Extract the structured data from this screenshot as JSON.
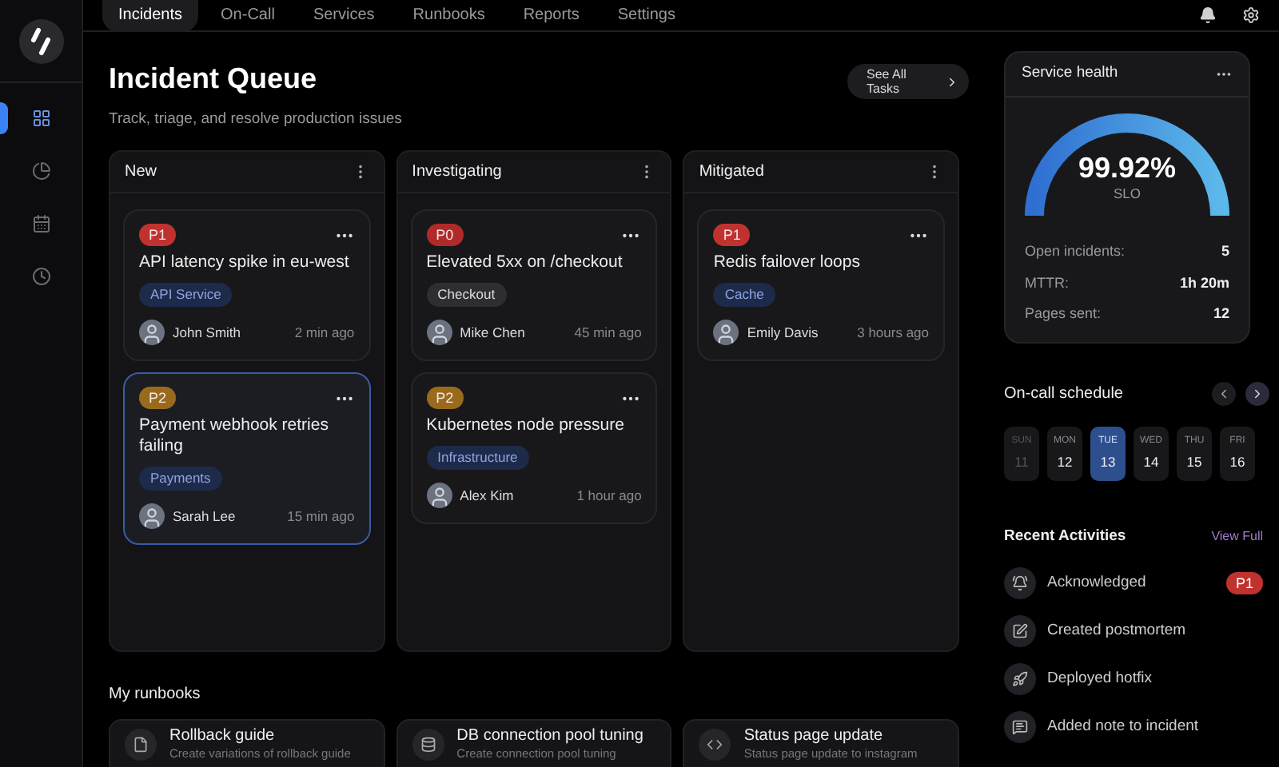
{
  "nav": {
    "tabs": [
      {
        "label": "Incidents",
        "selected": true
      },
      {
        "label": "On-Call",
        "selected": false
      },
      {
        "label": "Services",
        "selected": false
      },
      {
        "label": "Runbooks",
        "selected": false
      },
      {
        "label": "Reports",
        "selected": false
      },
      {
        "label": "Settings",
        "selected": false
      }
    ]
  },
  "sidebar": {
    "items": [
      {
        "kind": "grid",
        "selected": true
      },
      {
        "kind": "pie",
        "selected": false
      },
      {
        "kind": "calendar",
        "selected": false
      },
      {
        "kind": "clock",
        "selected": false
      }
    ]
  },
  "page": {
    "title": "Incident Queue",
    "subtitle": "Track, triage, and resolve production issues",
    "see_all": "See All Tasks"
  },
  "columns": [
    {
      "title": "New",
      "cards": [
        {
          "priority": {
            "label": "P1",
            "color": "#c0322e"
          },
          "title": "API latency spike in eu-west",
          "tag": {
            "label": "API Service",
            "color": "#1e2a4a"
          },
          "assignee": "John Smith",
          "time": "2 min ago",
          "selected": false
        },
        {
          "priority": {
            "label": "P2",
            "color": "#9a6a1c"
          },
          "title": "Payment webhook retries failing",
          "tag": {
            "label": "Payments",
            "color": "#1e2a4a"
          },
          "assignee": "Sarah Lee",
          "time": "15 min ago",
          "selected": true
        }
      ]
    },
    {
      "title": "Investigating",
      "cards": [
        {
          "priority": {
            "label": "P0",
            "color": "#b02a2a"
          },
          "title": "Elevated 5xx on /checkout",
          "tag": {
            "label": "Checkout",
            "color": "#2e2e30"
          },
          "assignee": "Mike Chen",
          "time": "45 min ago",
          "selected": false
        },
        {
          "priority": {
            "label": "P2",
            "color": "#9a6a1c"
          },
          "title": "Kubernetes node pressure",
          "tag": {
            "label": "Infrastructure",
            "color": "#1e2a4a"
          },
          "assignee": "Alex Kim",
          "time": "1 hour ago",
          "selected": false
        }
      ]
    },
    {
      "title": "Mitigated",
      "cards": [
        {
          "priority": {
            "label": "P1",
            "color": "#c0322e"
          },
          "title": "Redis failover loops",
          "tag": {
            "label": "Cache",
            "color": "#1e2a4a"
          },
          "assignee": "Emily Davis",
          "time": "3 hours ago",
          "selected": false
        }
      ]
    }
  ],
  "runbooks": {
    "title": "My runbooks",
    "items": [
      {
        "kind": "file",
        "title": "Rollback guide",
        "description": "Create variations of rollback guide"
      },
      {
        "kind": "database",
        "title": "DB connection pool tuning",
        "description": "Create connection pool tuning"
      },
      {
        "kind": "code",
        "title": "Status page update",
        "description": "Status page update to instagram"
      }
    ]
  },
  "service_health": {
    "title": "Service health",
    "value": "99.92%",
    "caption": "SLO",
    "stats": [
      {
        "label": "Open incidents:",
        "value": "5"
      },
      {
        "label": "MTTR:",
        "value": "1h 20m"
      },
      {
        "label": "Pages sent:",
        "value": "12"
      }
    ]
  },
  "schedule": {
    "title": "On-call schedule",
    "days": [
      {
        "day": "SUN",
        "date": "11",
        "selected": false,
        "disabled": true
      },
      {
        "day": "MON",
        "date": "12",
        "selected": false,
        "disabled": false
      },
      {
        "day": "TUE",
        "date": "13",
        "selected": true,
        "disabled": false
      },
      {
        "day": "WED",
        "date": "14",
        "selected": false,
        "disabled": false
      },
      {
        "day": "THU",
        "date": "15",
        "selected": false,
        "disabled": false
      },
      {
        "day": "FRI",
        "date": "16",
        "selected": false,
        "disabled": false
      }
    ]
  },
  "activities": {
    "title": "Recent Activities",
    "link": "View Full",
    "items": [
      {
        "kind": "bell",
        "text": "Acknowledged",
        "badge": "P1"
      },
      {
        "kind": "edit",
        "text": "Created postmortem"
      },
      {
        "kind": "rocket",
        "text": "Deployed hotfix"
      },
      {
        "kind": "note",
        "text": "Added note to incident"
      }
    ]
  }
}
